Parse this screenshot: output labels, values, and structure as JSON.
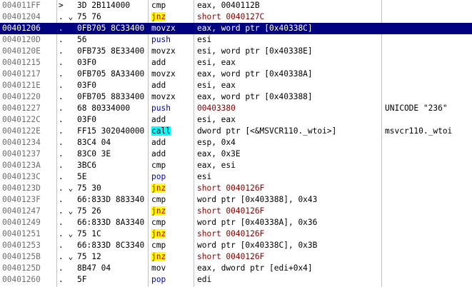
{
  "rows": [
    {
      "addr": "004011FF",
      "mark": ">",
      "hex": "3D 2B114000",
      "mnem": "cmp",
      "ops": "eax, 0040112B",
      "type": "normal",
      "cmt": ""
    },
    {
      "addr": "00401204",
      "mark": ". ⌄",
      "hex": "75 76",
      "mnem": "jnz",
      "ops": "short 0040127C",
      "type": "jump",
      "cmt": ""
    },
    {
      "addr": "00401206",
      "mark": ".",
      "hex": "0FB705 8C33400",
      "mnem": "movzx",
      "ops": "eax, word ptr [0x40338C]",
      "type": "normal",
      "cmt": "",
      "selected": true
    },
    {
      "addr": "0040120D",
      "mark": ".",
      "hex": "56",
      "mnem": "push",
      "ops": "esi",
      "type": "push",
      "cmt": ""
    },
    {
      "addr": "0040120E",
      "mark": ".",
      "hex": "0FB735 8E33400",
      "mnem": "movzx",
      "ops": "esi, word ptr [0x40338E]",
      "type": "normal",
      "cmt": ""
    },
    {
      "addr": "00401215",
      "mark": ".",
      "hex": "03F0",
      "mnem": "add",
      "ops": "esi, eax",
      "type": "normal",
      "cmt": ""
    },
    {
      "addr": "00401217",
      "mark": ".",
      "hex": "0FB705 8A33400",
      "mnem": "movzx",
      "ops": "eax, word ptr [0x40338A]",
      "type": "normal",
      "cmt": ""
    },
    {
      "addr": "0040121E",
      "mark": ".",
      "hex": "03F0",
      "mnem": "add",
      "ops": "esi, eax",
      "type": "normal",
      "cmt": ""
    },
    {
      "addr": "00401220",
      "mark": ".",
      "hex": "0FB705 8833400",
      "mnem": "movzx",
      "ops": "eax, word ptr [0x403388]",
      "type": "normal",
      "cmt": ""
    },
    {
      "addr": "00401227",
      "mark": ".",
      "hex": "68 80334000",
      "mnem": "push",
      "ops": "00403380",
      "type": "push-imm",
      "cmt": "UNICODE \"236\""
    },
    {
      "addr": "0040122C",
      "mark": ".",
      "hex": "03F0",
      "mnem": "add",
      "ops": "esi, eax",
      "type": "normal",
      "cmt": ""
    },
    {
      "addr": "0040122E",
      "mark": ".",
      "hex": "FF15 302040000",
      "mnem": "call",
      "ops": "dword ptr [<&MSVCR110._wtoi>]",
      "type": "call",
      "cmt": "msvcr110._wtoi"
    },
    {
      "addr": "00401234",
      "mark": ".",
      "hex": "83C4 04",
      "mnem": "add",
      "ops": "esp, 0x4",
      "type": "normal",
      "cmt": ""
    },
    {
      "addr": "00401237",
      "mark": ".",
      "hex": "83C0 3E",
      "mnem": "add",
      "ops": "eax, 0x3E",
      "type": "normal",
      "cmt": ""
    },
    {
      "addr": "0040123A",
      "mark": ".",
      "hex": "3BC6",
      "mnem": "cmp",
      "ops": "eax, esi",
      "type": "normal",
      "cmt": ""
    },
    {
      "addr": "0040123C",
      "mark": ".",
      "hex": "5E",
      "mnem": "pop",
      "ops": "esi",
      "type": "push",
      "cmt": ""
    },
    {
      "addr": "0040123D",
      "mark": ". ⌄",
      "hex": "75 30",
      "mnem": "jnz",
      "ops": "short 0040126F",
      "type": "jump",
      "cmt": ""
    },
    {
      "addr": "0040123F",
      "mark": ".",
      "hex": "66:833D 883340",
      "mnem": "cmp",
      "ops": "word ptr [0x403388], 0x43",
      "type": "normal",
      "cmt": ""
    },
    {
      "addr": "00401247",
      "mark": ". ⌄",
      "hex": "75 26",
      "mnem": "jnz",
      "ops": "short 0040126F",
      "type": "jump",
      "cmt": ""
    },
    {
      "addr": "00401249",
      "mark": ".",
      "hex": "66:833D 8A3340",
      "mnem": "cmp",
      "ops": "word ptr [0x40338A], 0x36",
      "type": "normal",
      "cmt": ""
    },
    {
      "addr": "00401251",
      "mark": ". ⌄",
      "hex": "75 1C",
      "mnem": "jnz",
      "ops": "short 0040126F",
      "type": "jump",
      "cmt": ""
    },
    {
      "addr": "00401253",
      "mark": ".",
      "hex": "66:833D 8C3340",
      "mnem": "cmp",
      "ops": "word ptr [0x40338C], 0x3B",
      "type": "normal",
      "cmt": ""
    },
    {
      "addr": "0040125B",
      "mark": ". ⌄",
      "hex": "75 12",
      "mnem": "jnz",
      "ops": "short 0040126F",
      "type": "jump",
      "cmt": ""
    },
    {
      "addr": "0040125D",
      "mark": ".",
      "hex": "8B47 04",
      "mnem": "mov",
      "ops": "eax, dword ptr [edi+0x4]",
      "type": "normal",
      "cmt": ""
    },
    {
      "addr": "00401260",
      "mark": ".",
      "hex": "5F",
      "mnem": "pop",
      "ops": "edi",
      "type": "push",
      "cmt": ""
    }
  ]
}
